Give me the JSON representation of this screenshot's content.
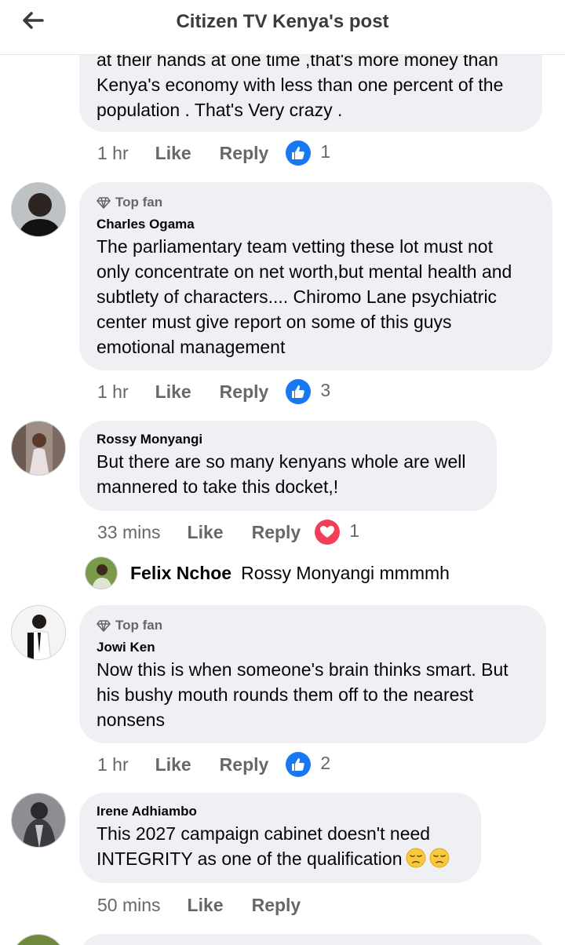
{
  "header": {
    "title": "Citizen TV Kenya's post"
  },
  "comments": [
    {
      "text": "at their hands  at one time ,that's more money than Kenya's economy with less than one percent of the population . That's Very crazy .",
      "lines": [
        "at their hands  at one time ,that's more money than",
        "Kenya's economy with less than one percent of the",
        "population . That's Very crazy ."
      ],
      "time": "1 hr",
      "like_label": "Like",
      "reply_label": "Reply",
      "reaction": "like",
      "reaction_count": "1"
    },
    {
      "badge": "Top fan",
      "author": "Charles Ogama",
      "lines": [
        "The parliamentary team vetting these lot must not",
        "only concentrate on net worth,but mental health and",
        "subtlety of characters.... Chiromo Lane psychiatric",
        "center must give report on some of this guys",
        "emotional management"
      ],
      "time": "1 hr",
      "like_label": "Like",
      "reply_label": "Reply",
      "reaction": "like",
      "reaction_count": "3"
    },
    {
      "author": "Rossy Monyangi",
      "lines": [
        "But there are so many kenyans whole are well",
        "mannered to take this docket,!"
      ],
      "time": "33 mins",
      "like_label": "Like",
      "reply_label": "Reply",
      "reaction": "love",
      "reaction_count": "1",
      "reply": {
        "author": "Felix Nchoe",
        "text": "Rossy Monyangi mmmmh"
      }
    },
    {
      "badge": "Top fan",
      "author": "Jowi Ken",
      "lines": [
        "Now this is when someone's brain thinks smart. But",
        "his bushy mouth rounds them off to the nearest",
        "nonsens"
      ],
      "time": "1 hr",
      "like_label": "Like",
      "reply_label": "Reply",
      "reaction": "like",
      "reaction_count": "2"
    },
    {
      "author": "Irene Adhiambo",
      "lines": [
        "This 2027 campaign cabinet doesn't need",
        "INTEGRITY as one of the qualification"
      ],
      "emoji": "pensive-face-emoji",
      "time": "50 mins",
      "like_label": "Like",
      "reply_label": "Reply"
    }
  ],
  "colors": {
    "like_blue": "#1877f2",
    "love_red": "#f33e58",
    "bubble": "#eef0f4",
    "meta_gray": "#65676b"
  }
}
